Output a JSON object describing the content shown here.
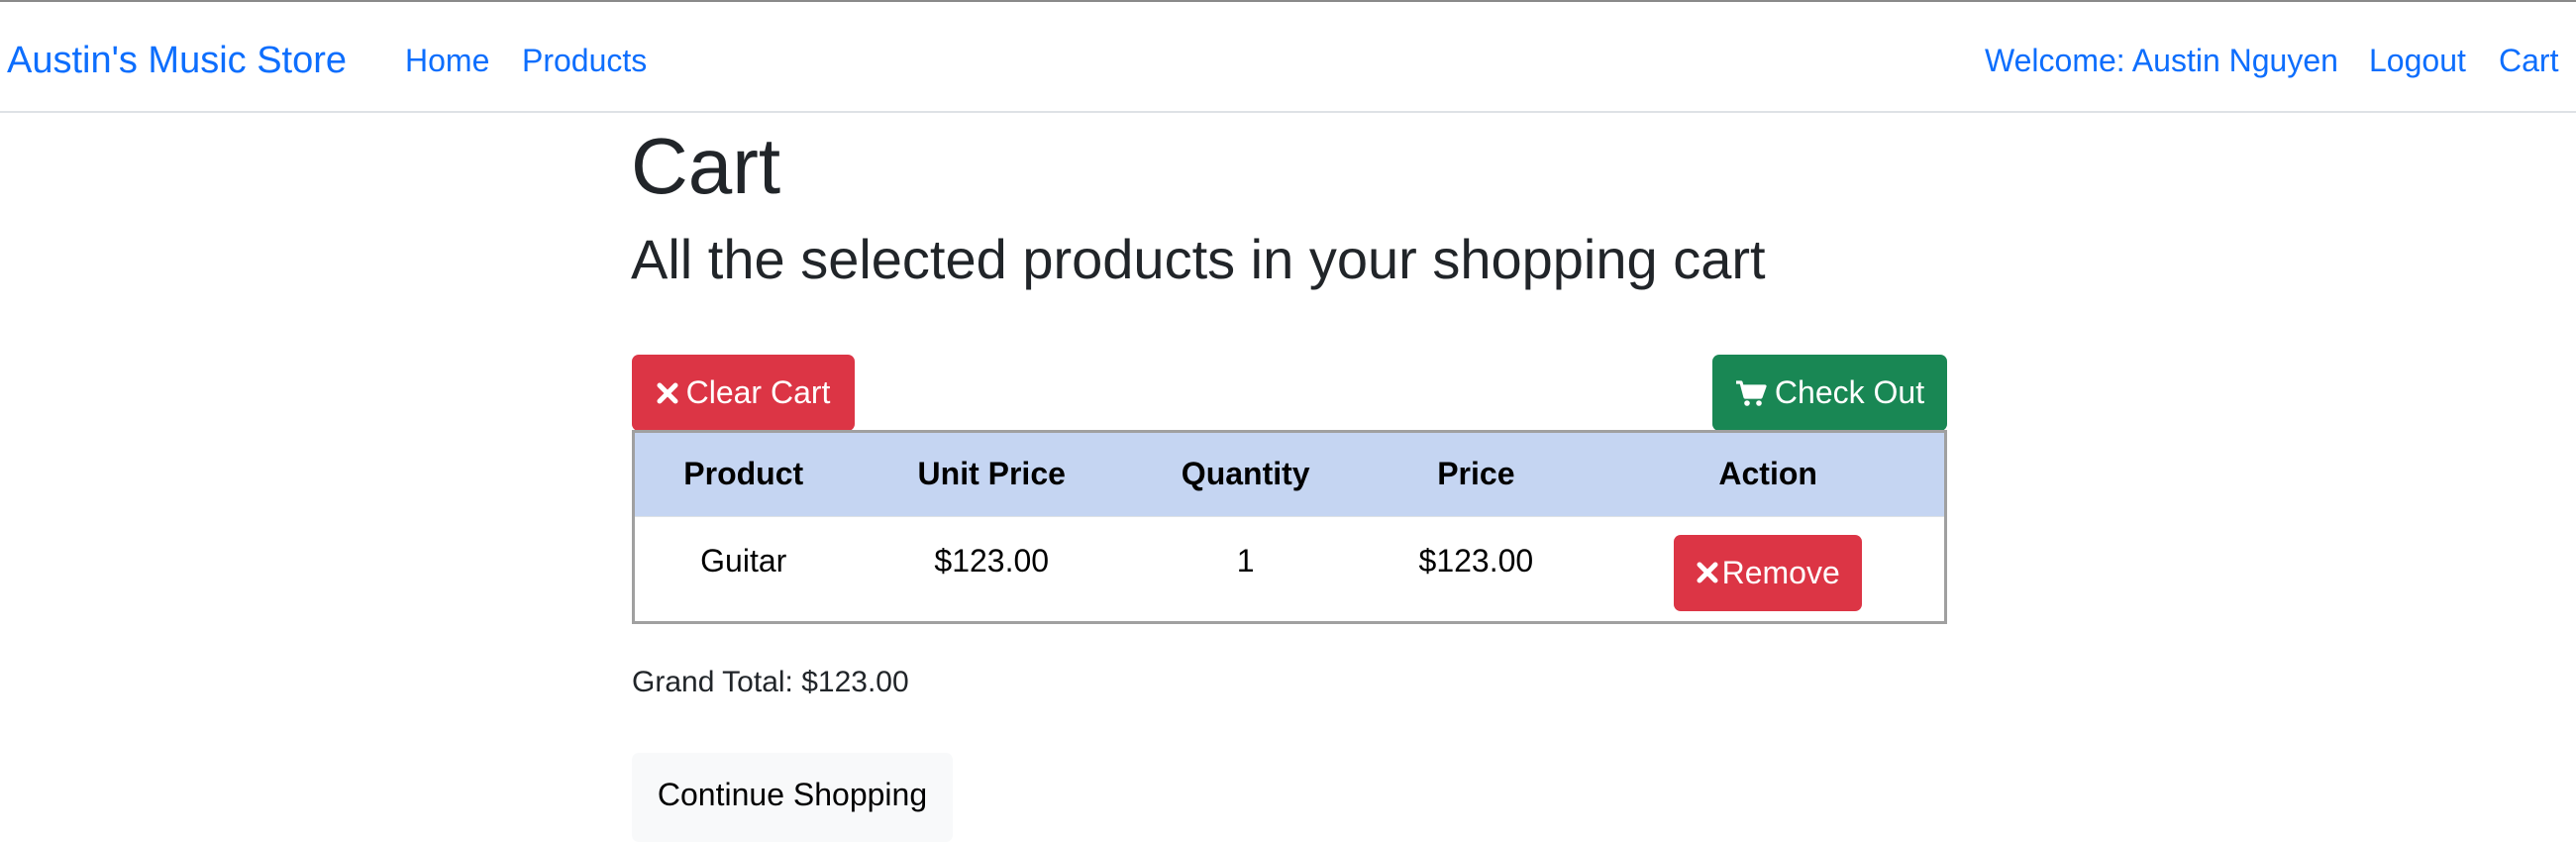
{
  "navbar": {
    "brand": "Austin's Music Store",
    "links": {
      "home": "Home",
      "products": "Products",
      "welcome": "Welcome: Austin Nguyen",
      "logout": "Logout",
      "cart": "Cart"
    }
  },
  "page": {
    "title": "Cart",
    "subtitle": "All the selected products in your shopping cart"
  },
  "actions": {
    "clear_cart": "Clear Cart",
    "check_out": "Check Out",
    "continue_shopping": "Continue Shopping"
  },
  "table": {
    "headers": [
      "Product",
      "Unit Price",
      "Quantity",
      "Price",
      "Action"
    ],
    "rows": [
      {
        "product": "Guitar",
        "unit_price": "$123.00",
        "quantity": "1",
        "price": "$123.00",
        "action": "Remove"
      }
    ]
  },
  "grand_total": "Grand Total: $123.00",
  "icons": {
    "clear": "times-icon",
    "checkout": "shopping-cart-icon",
    "remove": "times-icon"
  },
  "colors": {
    "link": "#0d6efd",
    "danger": "#dc3545",
    "success": "#198754",
    "table_header": "#c5d5f2",
    "light_button": "#f8f9fa"
  }
}
